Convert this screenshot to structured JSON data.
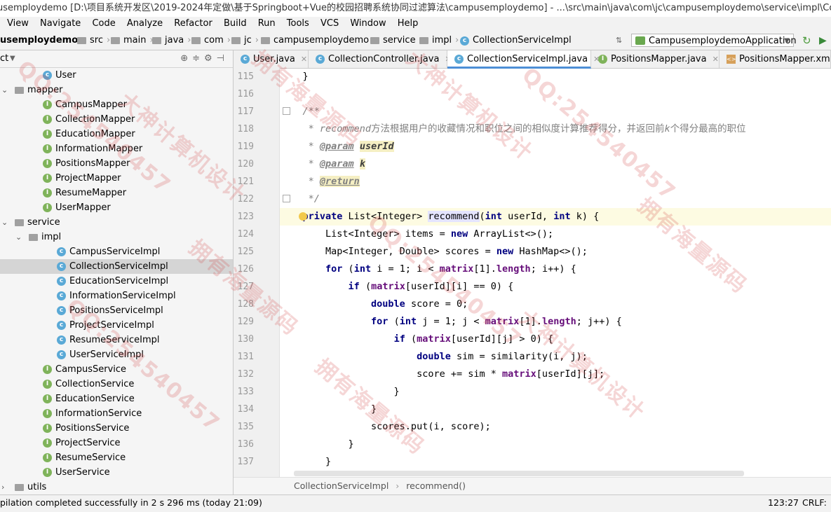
{
  "window": {
    "title": "usemploydemo [D:\\项目系统开发区\\2019-2024年定做\\基于Springboot+Vue的校园招聘系统协同过滤算法\\campusemploydemo] - ...\\src\\main\\java\\com\\jc\\campusemploydemo\\service\\impl\\CollectionServic..."
  },
  "menu": [
    "View",
    "Navigate",
    "Code",
    "Analyze",
    "Refactor",
    "Build",
    "Run",
    "Tools",
    "VCS",
    "Window",
    "Help"
  ],
  "nav": {
    "crumbs": [
      "usemploydemo",
      "src",
      "main",
      "java",
      "com",
      "jc",
      "campusemploydemo",
      "service",
      "impl",
      "CollectionServiceImpl"
    ],
    "run_config": "CampusemploydemoApplication"
  },
  "project": {
    "header": "ct",
    "tree": [
      {
        "label": "User",
        "kind": "class"
      },
      {
        "label": "mapper",
        "kind": "folder"
      },
      {
        "label": "CampusMapper",
        "kind": "interface"
      },
      {
        "label": "CollectionMapper",
        "kind": "interface"
      },
      {
        "label": "EducationMapper",
        "kind": "interface"
      },
      {
        "label": "InformationMapper",
        "kind": "interface"
      },
      {
        "label": "PositionsMapper",
        "kind": "interface"
      },
      {
        "label": "ProjectMapper",
        "kind": "interface"
      },
      {
        "label": "ResumeMapper",
        "kind": "interface"
      },
      {
        "label": "UserMapper",
        "kind": "interface"
      },
      {
        "label": "service",
        "kind": "folder"
      },
      {
        "label": "impl",
        "kind": "folder"
      },
      {
        "label": "CampusServiceImpl",
        "kind": "class"
      },
      {
        "label": "CollectionServiceImpl",
        "kind": "class"
      },
      {
        "label": "EducationServiceImpl",
        "kind": "class"
      },
      {
        "label": "InformationServiceImpl",
        "kind": "class"
      },
      {
        "label": "PositionsServiceImpl",
        "kind": "class"
      },
      {
        "label": "ProjectServiceImpl",
        "kind": "class"
      },
      {
        "label": "ResumeServiceImpl",
        "kind": "class"
      },
      {
        "label": "UserServiceImpl",
        "kind": "class"
      },
      {
        "label": "CampusService",
        "kind": "interface"
      },
      {
        "label": "CollectionService",
        "kind": "interface"
      },
      {
        "label": "EducationService",
        "kind": "interface"
      },
      {
        "label": "InformationService",
        "kind": "interface"
      },
      {
        "label": "PositionsService",
        "kind": "interface"
      },
      {
        "label": "ProjectService",
        "kind": "interface"
      },
      {
        "label": "ResumeService",
        "kind": "interface"
      },
      {
        "label": "UserService",
        "kind": "interface"
      },
      {
        "label": "utils",
        "kind": "folder"
      }
    ]
  },
  "tabs": [
    "User.java",
    "CollectionController.java",
    "CollectionServiceImpl.java",
    "PositionsMapper.java",
    "PositionsMapper.xml"
  ],
  "code": {
    "line_numbers": [
      "115",
      "116",
      "117",
      "118",
      "119",
      "120",
      "121",
      "122",
      "123",
      "124",
      "125",
      "126",
      "127",
      "128",
      "129",
      "130",
      "131",
      "132",
      "133",
      "134",
      "135",
      "136",
      "137"
    ],
    "comment_text": "方法根据用户的收藏情况和职位之间的相似度计算推荐得分，并返回前",
    "comment_text2": "个得分最高的职位"
  },
  "editor_breadcrumb": [
    "CollectionServiceImpl",
    "recommend()"
  ],
  "status": {
    "message": "pilation completed successfully in 2 s 296 ms (today 21:09)",
    "position": "123:27",
    "line_sep": "CRLF:"
  },
  "watermarks": [
    "大神计算机设计",
    "QQ:254540457",
    "拥有海量源码"
  ]
}
